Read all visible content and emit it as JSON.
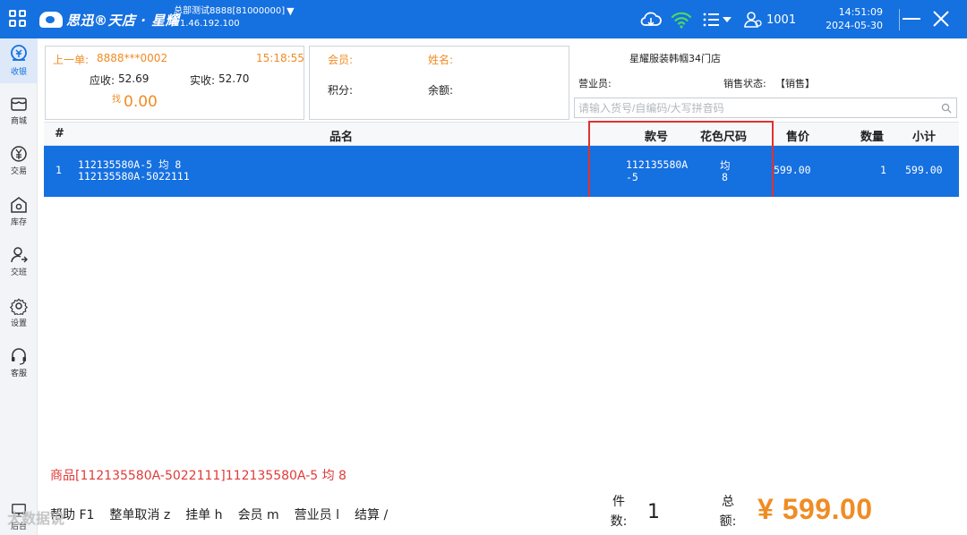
{
  "topbar": {
    "brand": "思迅®天店 · 星耀",
    "store_account": "总部测试8888[81000000]",
    "version": "V1.46.192.100",
    "user_id": "1001",
    "time": "14:51:09",
    "date": "2024-05-30",
    "accent": "#1570e0"
  },
  "sidebar": {
    "items": [
      {
        "label": "收银",
        "icon": "cashier-icon",
        "active": true
      },
      {
        "label": "商城",
        "icon": "mall-icon"
      },
      {
        "label": "交易",
        "icon": "yuan-icon"
      },
      {
        "label": "库存",
        "icon": "inventory-icon"
      },
      {
        "label": "交班",
        "icon": "handover-icon"
      },
      {
        "label": "设置",
        "icon": "gear-icon"
      },
      {
        "label": "客服",
        "icon": "headset-icon"
      },
      {
        "label": "后台",
        "icon": "backend-icon"
      }
    ]
  },
  "last_order": {
    "label": "上一单:",
    "order_no": "8888***0002",
    "time": "15:18:55",
    "receivable_label": "应收:",
    "receivable": "52.69",
    "received_label": "实收:",
    "received": "52.70",
    "change_label": "找",
    "change": "0.00"
  },
  "member": {
    "member_label": "会员:",
    "name_label": "姓名:",
    "points_label": "积分:",
    "balance_label": "余额:"
  },
  "store": {
    "name": "星耀服装韩帼34门店",
    "clerk_label": "营业员:",
    "status_label": "销售状态:",
    "status_value": "【销售】",
    "search_placeholder": "请输入货号/自编码/大写拼音码"
  },
  "table": {
    "headers": {
      "index": "#",
      "name": "品名",
      "code": "款号",
      "color_size": "花色尺码",
      "price": "售价",
      "qty": "数量",
      "subtotal": "小计"
    },
    "rows": [
      {
        "index": "1",
        "name_line1": "112135580A-5 均 8",
        "name_line2": "112135580A-5022111",
        "code_line1": "112135580A",
        "code_line2": "-5",
        "color": "均",
        "size": "8",
        "price": "599.00",
        "qty": "1",
        "subtotal": "599.00"
      }
    ]
  },
  "footer": {
    "item_message": "商品[112135580A-5022111]112135580A-5 均 8",
    "hotkeys": [
      "帮助 F1",
      "整单取消 z",
      "挂单 h",
      "会员 m",
      "营业员 l",
      "结算 /"
    ],
    "count_label_1": "件",
    "count_label_2": "数:",
    "count": "1",
    "total_label_1": "总",
    "total_label_2": "额:",
    "total": "¥ 599.00",
    "watermark": "大数据说"
  }
}
